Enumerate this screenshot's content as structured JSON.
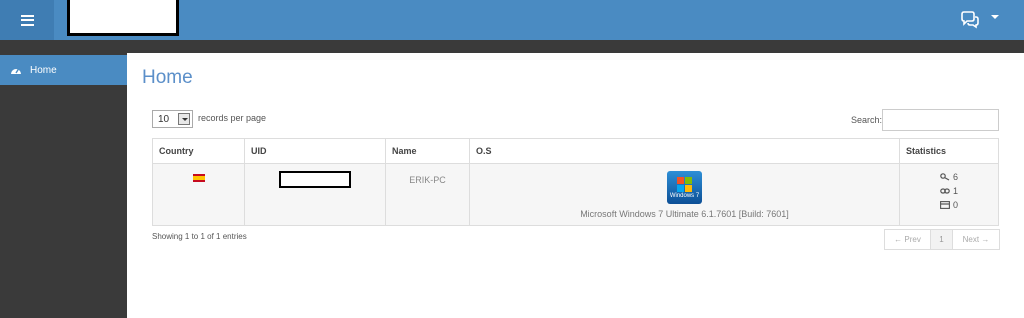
{
  "sidebar": {
    "items": [
      {
        "label": "Home",
        "icon": "dashboard-icon"
      }
    ]
  },
  "main": {
    "title": "Home",
    "length": {
      "value": "10",
      "label": "records per page"
    },
    "search": {
      "label": "Search:",
      "value": ""
    },
    "table": {
      "headers": [
        "Country",
        "UID",
        "Name",
        "O.S",
        "Statistics"
      ],
      "rows": [
        {
          "country": "spain-flag",
          "uid": "",
          "name": "ERIK-PC",
          "os_badge": "Windows 7",
          "os": "Microsoft Windows 7 Ultimate 6.1.7601 [Build: 7601]",
          "stats": [
            {
              "icon": "key-icon",
              "value": "6"
            },
            {
              "icon": "link-icon",
              "value": "1"
            },
            {
              "icon": "card-icon",
              "value": "0"
            }
          ]
        }
      ]
    },
    "info": "Showing 1 to 1 of 1 entries",
    "pagination": {
      "prev": "← Prev",
      "page": "1",
      "next": "Next →"
    }
  },
  "colors": {
    "accent": "#4a8bc2",
    "dark": "#3a3a3a",
    "title": "#5b8fc9"
  }
}
